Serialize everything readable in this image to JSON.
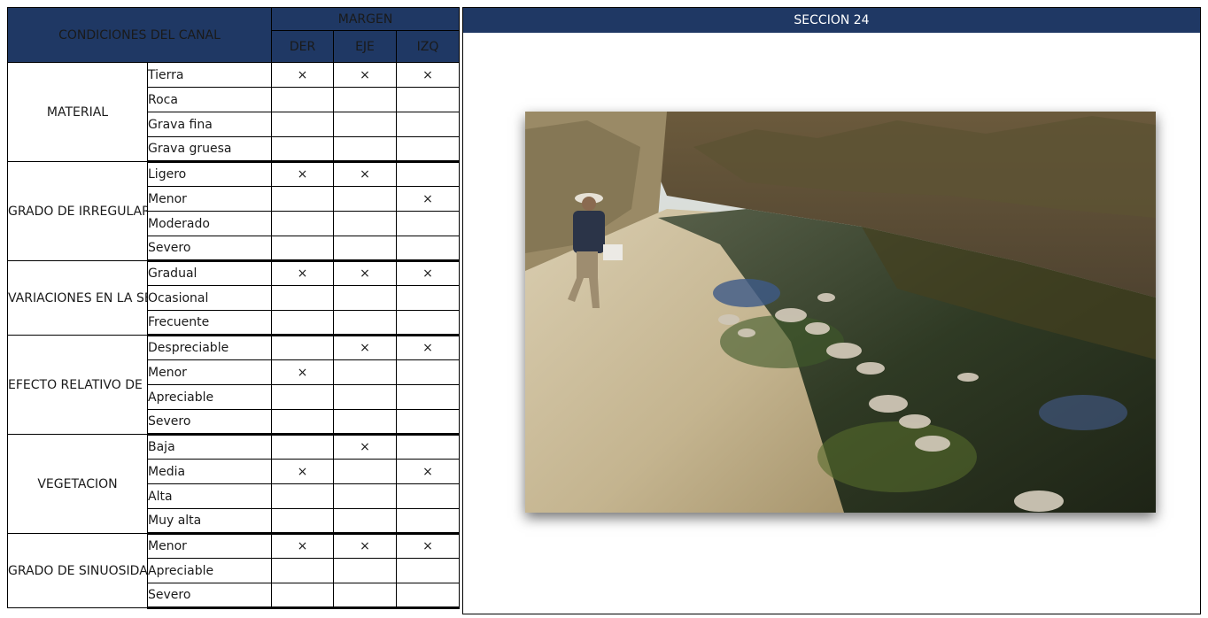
{
  "header": {
    "conditions": "CONDICIONES DEL CANAL",
    "margin": "MARGEN",
    "columns": [
      "DER",
      "EJE",
      "IZQ"
    ],
    "section": "SECCION 24"
  },
  "groups": [
    {
      "name": "MATERIAL",
      "rows": [
        {
          "option": "Tierra",
          "der": "×",
          "eje": "×",
          "izq": "×"
        },
        {
          "option": "Roca",
          "der": "",
          "eje": "",
          "izq": ""
        },
        {
          "option": "Grava fina",
          "der": "",
          "eje": "",
          "izq": ""
        },
        {
          "option": "Grava gruesa",
          "der": "",
          "eje": "",
          "izq": ""
        }
      ]
    },
    {
      "name": "GRADO DE IRREGULARIDAD",
      "rows": [
        {
          "option": "Ligero",
          "der": "×",
          "eje": "×",
          "izq": ""
        },
        {
          "option": "Menor",
          "der": "",
          "eje": "",
          "izq": "×"
        },
        {
          "option": "Moderado",
          "der": "",
          "eje": "",
          "izq": ""
        },
        {
          "option": "Severo",
          "der": "",
          "eje": "",
          "izq": ""
        }
      ]
    },
    {
      "name": "VARIACIONES EN LA SECCION TRANSVERSAL DEL CANAL",
      "rows": [
        {
          "option": "Gradual",
          "der": "×",
          "eje": "×",
          "izq": "×"
        },
        {
          "option": "Ocasional",
          "der": "",
          "eje": "",
          "izq": ""
        },
        {
          "option": "Frecuente",
          "der": "",
          "eje": "",
          "izq": ""
        }
      ]
    },
    {
      "name": "EFECTO RELATIVO DE OBSTACULOS",
      "rows": [
        {
          "option": "Despreciable",
          "der": "",
          "eje": "×",
          "izq": "×"
        },
        {
          "option": "Menor",
          "der": "×",
          "eje": "",
          "izq": ""
        },
        {
          "option": "Apreciable",
          "der": "",
          "eje": "",
          "izq": ""
        },
        {
          "option": "Severo",
          "der": "",
          "eje": "",
          "izq": ""
        }
      ]
    },
    {
      "name": "VEGETACION",
      "rows": [
        {
          "option": "Baja",
          "der": "",
          "eje": "×",
          "izq": ""
        },
        {
          "option": "Media",
          "der": "×",
          "eje": "",
          "izq": "×"
        },
        {
          "option": "Alta",
          "der": "",
          "eje": "",
          "izq": ""
        },
        {
          "option": "Muy alta",
          "der": "",
          "eje": "",
          "izq": ""
        }
      ]
    },
    {
      "name": "GRADO DE SINUOSIDAD",
      "rows": [
        {
          "option": "Menor",
          "der": "×",
          "eje": "×",
          "izq": "×"
        },
        {
          "option": "Apreciable",
          "der": "",
          "eje": "",
          "izq": ""
        },
        {
          "option": "Severo",
          "der": "",
          "eje": "",
          "izq": ""
        }
      ]
    }
  ],
  "colors": {
    "header_bg": "#1f3864",
    "header_text": "#ffffff"
  }
}
